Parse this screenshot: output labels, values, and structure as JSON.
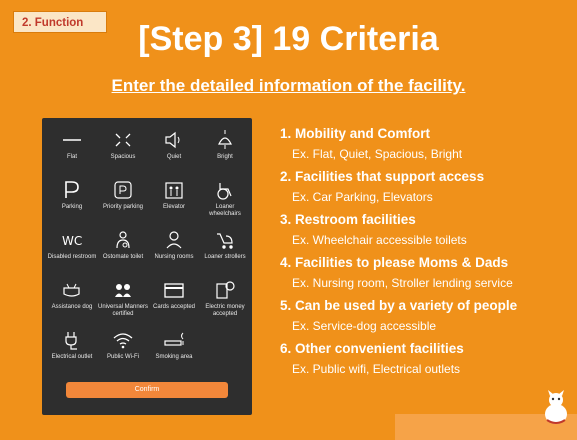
{
  "section_tag": "2. Function",
  "title": "[Step 3] 19 Criteria",
  "subtitle": "Enter the detailed information of the facility.",
  "phone": {
    "items": [
      {
        "label": "Flat",
        "icon": "flat-line-icon"
      },
      {
        "label": "Spacious",
        "icon": "spacious-arrows-icon"
      },
      {
        "label": "Quiet",
        "icon": "quiet-speaker-icon"
      },
      {
        "label": "Bright",
        "icon": "bright-lamp-icon"
      },
      {
        "label": "Parking",
        "icon": "parking-icon"
      },
      {
        "label": "Priority parking",
        "icon": "priority-parking-icon"
      },
      {
        "label": "Elevator",
        "icon": "elevator-icon"
      },
      {
        "label": "Loaner wheelchairs",
        "icon": "wheelchair-icon"
      },
      {
        "label": "Disabled restroom",
        "icon": "disabled-restroom-icon"
      },
      {
        "label": "Ostomate toilet",
        "icon": "ostomate-icon"
      },
      {
        "label": "Nursing rooms",
        "icon": "nursing-room-icon"
      },
      {
        "label": "Loaner strollers",
        "icon": "stroller-icon"
      },
      {
        "label": "Assistance dog",
        "icon": "assistance-dog-icon"
      },
      {
        "label": "Universal Manners certified",
        "icon": "universal-manners-icon"
      },
      {
        "label": "Cards accepted",
        "icon": "credit-card-icon"
      },
      {
        "label": "Electric money accepted",
        "icon": "electric-money-icon"
      },
      {
        "label": "Electrical outlet",
        "icon": "outlet-plug-icon"
      },
      {
        "label": "Public Wi-Fi",
        "icon": "wifi-icon"
      },
      {
        "label": "Smoking area",
        "icon": "smoking-area-icon"
      }
    ],
    "confirm_label": "Confirm"
  },
  "criteria": [
    {
      "heading": "1. Mobility and Comfort",
      "example": "Ex. Flat, Quiet, Spacious, Bright"
    },
    {
      "heading": "2. Facilities that support access",
      "example": "Ex. Car Parking, Elevators"
    },
    {
      "heading": "3. Restroom facilities",
      "example": "Ex. Wheelchair accessible toilets"
    },
    {
      "heading": "4. Facilities to please Moms & Dads",
      "example": "Ex. Nursing room, Stroller lending service"
    },
    {
      "heading": "5. Can be used by a variety of people",
      "example": "Ex. Service-dog accessible"
    },
    {
      "heading": "6. Other convenient facilities",
      "example": "Ex. Public wifi, Electrical outlets"
    }
  ],
  "colors": {
    "background": "#f0911a",
    "phone": "#2e2e2e",
    "confirm": "#f2873a",
    "tag_bg": "#fbe6c6",
    "tag_text": "#c0392b"
  }
}
